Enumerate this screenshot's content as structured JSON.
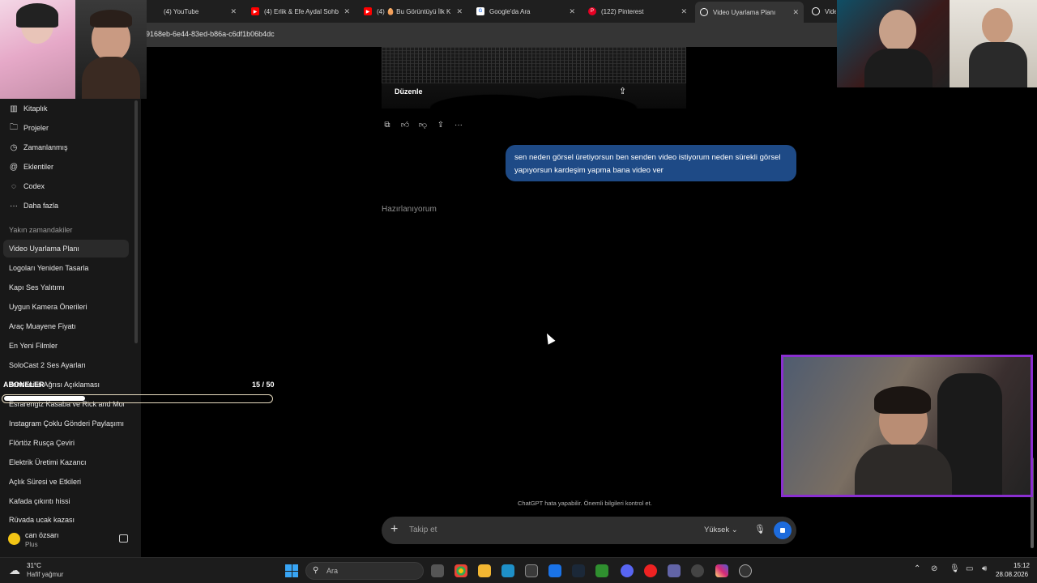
{
  "browser": {
    "tabs": [
      {
        "label": "(4) YouTube",
        "favicon": "youtube-icon",
        "favicon_color": "#ff0000"
      },
      {
        "label": "(4) Erlik & Efe Aydal Sohb",
        "favicon": "youtube-icon",
        "favicon_color": "#ff0000"
      },
      {
        "label": "(4) 🥚 Bu Görüntüyü İlk K",
        "favicon": "youtube-icon",
        "favicon_color": "#ff0000"
      },
      {
        "label": "Google'da Ara",
        "favicon": "google-icon",
        "favicon_color": "#ffffff"
      },
      {
        "label": "(122) Pinterest",
        "favicon": "pinterest-icon",
        "favicon_color": "#e60023"
      },
      {
        "label": "Video Uyarlama Planı",
        "favicon": "chatgpt-icon",
        "favicon_color": "#ffffff"
      },
      {
        "label": "Vide",
        "favicon": "chatgpt-icon",
        "favicon_color": "#ffffff"
      }
    ],
    "url": "9168eb-6e44-83ed-b86a-c6df1b06b4dc"
  },
  "sidebar": {
    "nav": [
      {
        "label": "Kitaplık",
        "icon": "library-icon"
      },
      {
        "label": "Projeler",
        "icon": "folder-icon"
      },
      {
        "label": "Zamanlanmış",
        "icon": "clock-icon"
      },
      {
        "label": "Eklentiler",
        "icon": "at-icon"
      },
      {
        "label": "Codex",
        "icon": "codex-icon"
      },
      {
        "label": "Daha fazla",
        "icon": "more-icon"
      }
    ],
    "recent_label": "Yakın zamandakiler",
    "chats": [
      "Video Uyarlama Planı",
      "Logoları Yeniden Tasarla",
      "Kapı Ses Yalıtımı",
      "Uygun Kamera Önerileri",
      "Araç Muayene Fiyatı",
      "En Yeni Filmler",
      "SoloCast 2 Ses Ayarları",
      "Tendonitis Ağrısı Açıklaması",
      "Esrarengiz Kasaba ve Rick and Morty",
      "Instagram Çoklu Gönderi Paylaşımı",
      "Flörtöz Rusça Çeviri",
      "Elektrik Üretimi Kazancı",
      "Açlık Süresi ve Etkileri",
      "Kafada çıkıntı hissi",
      "Rüyada uçak kazası"
    ],
    "user": {
      "name": "can özsarı",
      "plan": "Plus"
    }
  },
  "overlay": {
    "label": "ABONELER",
    "count": "15 / 50",
    "progress": 0.3
  },
  "conversation": {
    "image_action": "Düzenle",
    "user_message": "sen neden görsel üretiyorsun ben senden video istiyorum neden sürekli görsel yapıyorsun kardeşim yapma bana video ver",
    "status": "Hazırlanıyorum",
    "disclaimer": "ChatGPT hata yapabilir. Önemli bilgileri kontrol et."
  },
  "composer": {
    "placeholder": "Takip et",
    "model": "Yüksek"
  },
  "taskbar": {
    "temperature": "31°C",
    "condition": "Hafif yağmur",
    "search": "Ara",
    "time": "15:12",
    "date": "28.08.2026"
  },
  "colors": {
    "accent": "#1d6bdc",
    "user_bubble": "#1e4a86",
    "stream_frame": "#8a2fd0"
  }
}
